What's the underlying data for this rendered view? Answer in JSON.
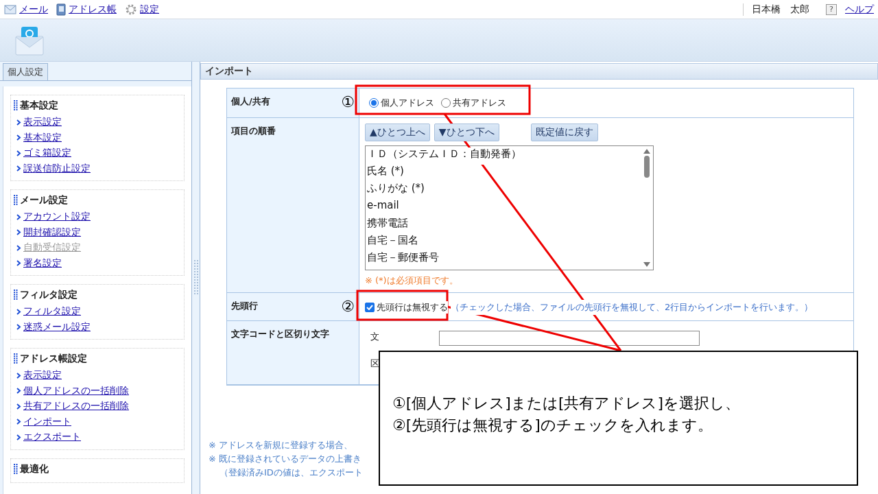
{
  "top_nav": {
    "links": [
      {
        "label": "メール"
      },
      {
        "label": "アドレス帳"
      },
      {
        "label": "設定"
      }
    ],
    "user": "日本橋　太郎",
    "help_icon": "?",
    "help": "ヘルプ"
  },
  "sidebar": {
    "tab": "個人設定",
    "sections": [
      {
        "title": "基本設定",
        "items": [
          {
            "label": "表示設定",
            "disabled": false
          },
          {
            "label": "基本設定",
            "disabled": false
          },
          {
            "label": "ゴミ箱設定",
            "disabled": false
          },
          {
            "label": "誤送信防止設定",
            "disabled": false
          }
        ]
      },
      {
        "title": "メール設定",
        "items": [
          {
            "label": "アカウント設定",
            "disabled": false
          },
          {
            "label": "開封確認設定",
            "disabled": false
          },
          {
            "label": "自動受信設定",
            "disabled": true
          },
          {
            "label": "署名設定",
            "disabled": false
          }
        ]
      },
      {
        "title": "フィルタ設定",
        "items": [
          {
            "label": "フィルタ設定",
            "disabled": false
          },
          {
            "label": "迷惑メール設定",
            "disabled": false
          }
        ]
      },
      {
        "title": "アドレス帳設定",
        "items": [
          {
            "label": "表示設定",
            "disabled": false
          },
          {
            "label": "個人アドレスの一括削除",
            "disabled": false
          },
          {
            "label": "共有アドレスの一括削除",
            "disabled": false
          },
          {
            "label": "インポート",
            "disabled": false
          },
          {
            "label": "エクスポート",
            "disabled": false
          }
        ]
      },
      {
        "title": "最適化"
      }
    ]
  },
  "panel": {
    "title": "インポート",
    "rows": [
      {
        "kind": "radio",
        "label": "個人/共有",
        "marker": "①",
        "options": [
          {
            "label": "個人アドレス",
            "selected": true
          },
          {
            "label": "共有アドレス",
            "selected": false
          }
        ]
      },
      {
        "kind": "order",
        "label": "項目の順番",
        "buttons": [
          "▲ひとつ上へ",
          "▼ひとつ下へ",
          "既定値に戻す"
        ],
        "list": [
          "ＩＤ（システムＩＤ：自動発番）",
          "氏名 (*)",
          "ふりがな (*)",
          "e-mail",
          "携帯電話",
          "自宅－国名",
          "自宅－郵便番号"
        ],
        "note": "※ (*)は必須項目です。"
      },
      {
        "kind": "checkbox",
        "label": "先頭行",
        "marker": "②",
        "checkbox": {
          "label": "先頭行は無視する",
          "checked": true
        },
        "description": "（チェックした場合、ファイルの先頭行を無視して、2行目からインポートを行います。）"
      },
      {
        "kind": "encoding",
        "label": "文字コードと区切り文字",
        "fragments": [
          "文",
          "区"
        ]
      }
    ],
    "notes": [
      "※ アドレスを新規に登録する場合、",
      "※ 既に登録されているデータの上書き",
      "（登録済みIDの値は、エクスポート"
    ]
  },
  "callout": {
    "lines": [
      "①[個人アドレス]または[共有アドレス]を選択し、",
      "②[先頭行は無視する]のチェックを入れます。"
    ]
  }
}
